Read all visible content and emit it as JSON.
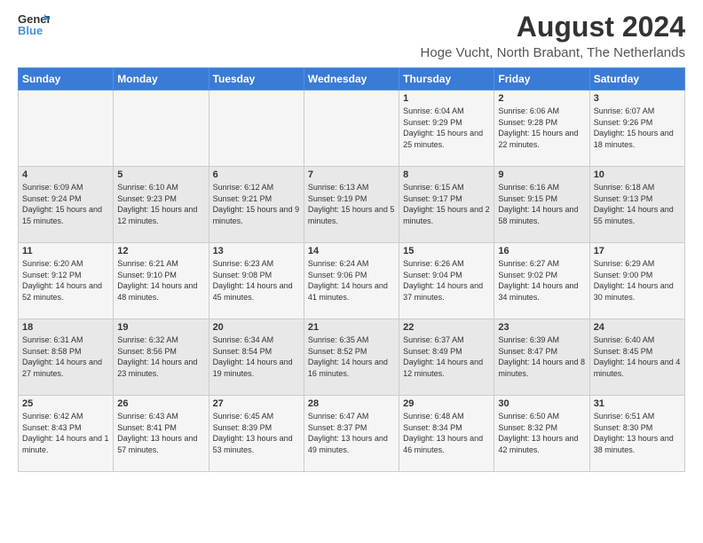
{
  "header": {
    "logo_line1": "General",
    "logo_line2": "Blue",
    "main_title": "August 2024",
    "subtitle": "Hoge Vucht, North Brabant, The Netherlands"
  },
  "calendar": {
    "days_of_week": [
      "Sunday",
      "Monday",
      "Tuesday",
      "Wednesday",
      "Thursday",
      "Friday",
      "Saturday"
    ],
    "weeks": [
      [
        {
          "day": "",
          "info": ""
        },
        {
          "day": "",
          "info": ""
        },
        {
          "day": "",
          "info": ""
        },
        {
          "day": "",
          "info": ""
        },
        {
          "day": "1",
          "info": "Sunrise: 6:04 AM\nSunset: 9:29 PM\nDaylight: 15 hours and 25 minutes."
        },
        {
          "day": "2",
          "info": "Sunrise: 6:06 AM\nSunset: 9:28 PM\nDaylight: 15 hours and 22 minutes."
        },
        {
          "day": "3",
          "info": "Sunrise: 6:07 AM\nSunset: 9:26 PM\nDaylight: 15 hours and 18 minutes."
        }
      ],
      [
        {
          "day": "4",
          "info": "Sunrise: 6:09 AM\nSunset: 9:24 PM\nDaylight: 15 hours and 15 minutes."
        },
        {
          "day": "5",
          "info": "Sunrise: 6:10 AM\nSunset: 9:23 PM\nDaylight: 15 hours and 12 minutes."
        },
        {
          "day": "6",
          "info": "Sunrise: 6:12 AM\nSunset: 9:21 PM\nDaylight: 15 hours and 9 minutes."
        },
        {
          "day": "7",
          "info": "Sunrise: 6:13 AM\nSunset: 9:19 PM\nDaylight: 15 hours and 5 minutes."
        },
        {
          "day": "8",
          "info": "Sunrise: 6:15 AM\nSunset: 9:17 PM\nDaylight: 15 hours and 2 minutes."
        },
        {
          "day": "9",
          "info": "Sunrise: 6:16 AM\nSunset: 9:15 PM\nDaylight: 14 hours and 58 minutes."
        },
        {
          "day": "10",
          "info": "Sunrise: 6:18 AM\nSunset: 9:13 PM\nDaylight: 14 hours and 55 minutes."
        }
      ],
      [
        {
          "day": "11",
          "info": "Sunrise: 6:20 AM\nSunset: 9:12 PM\nDaylight: 14 hours and 52 minutes."
        },
        {
          "day": "12",
          "info": "Sunrise: 6:21 AM\nSunset: 9:10 PM\nDaylight: 14 hours and 48 minutes."
        },
        {
          "day": "13",
          "info": "Sunrise: 6:23 AM\nSunset: 9:08 PM\nDaylight: 14 hours and 45 minutes."
        },
        {
          "day": "14",
          "info": "Sunrise: 6:24 AM\nSunset: 9:06 PM\nDaylight: 14 hours and 41 minutes."
        },
        {
          "day": "15",
          "info": "Sunrise: 6:26 AM\nSunset: 9:04 PM\nDaylight: 14 hours and 37 minutes."
        },
        {
          "day": "16",
          "info": "Sunrise: 6:27 AM\nSunset: 9:02 PM\nDaylight: 14 hours and 34 minutes."
        },
        {
          "day": "17",
          "info": "Sunrise: 6:29 AM\nSunset: 9:00 PM\nDaylight: 14 hours and 30 minutes."
        }
      ],
      [
        {
          "day": "18",
          "info": "Sunrise: 6:31 AM\nSunset: 8:58 PM\nDaylight: 14 hours and 27 minutes."
        },
        {
          "day": "19",
          "info": "Sunrise: 6:32 AM\nSunset: 8:56 PM\nDaylight: 14 hours and 23 minutes."
        },
        {
          "day": "20",
          "info": "Sunrise: 6:34 AM\nSunset: 8:54 PM\nDaylight: 14 hours and 19 minutes."
        },
        {
          "day": "21",
          "info": "Sunrise: 6:35 AM\nSunset: 8:52 PM\nDaylight: 14 hours and 16 minutes."
        },
        {
          "day": "22",
          "info": "Sunrise: 6:37 AM\nSunset: 8:49 PM\nDaylight: 14 hours and 12 minutes."
        },
        {
          "day": "23",
          "info": "Sunrise: 6:39 AM\nSunset: 8:47 PM\nDaylight: 14 hours and 8 minutes."
        },
        {
          "day": "24",
          "info": "Sunrise: 6:40 AM\nSunset: 8:45 PM\nDaylight: 14 hours and 4 minutes."
        }
      ],
      [
        {
          "day": "25",
          "info": "Sunrise: 6:42 AM\nSunset: 8:43 PM\nDaylight: 14 hours and 1 minute."
        },
        {
          "day": "26",
          "info": "Sunrise: 6:43 AM\nSunset: 8:41 PM\nDaylight: 13 hours and 57 minutes."
        },
        {
          "day": "27",
          "info": "Sunrise: 6:45 AM\nSunset: 8:39 PM\nDaylight: 13 hours and 53 minutes."
        },
        {
          "day": "28",
          "info": "Sunrise: 6:47 AM\nSunset: 8:37 PM\nDaylight: 13 hours and 49 minutes."
        },
        {
          "day": "29",
          "info": "Sunrise: 6:48 AM\nSunset: 8:34 PM\nDaylight: 13 hours and 46 minutes."
        },
        {
          "day": "30",
          "info": "Sunrise: 6:50 AM\nSunset: 8:32 PM\nDaylight: 13 hours and 42 minutes."
        },
        {
          "day": "31",
          "info": "Sunrise: 6:51 AM\nSunset: 8:30 PM\nDaylight: 13 hours and 38 minutes."
        }
      ]
    ]
  }
}
